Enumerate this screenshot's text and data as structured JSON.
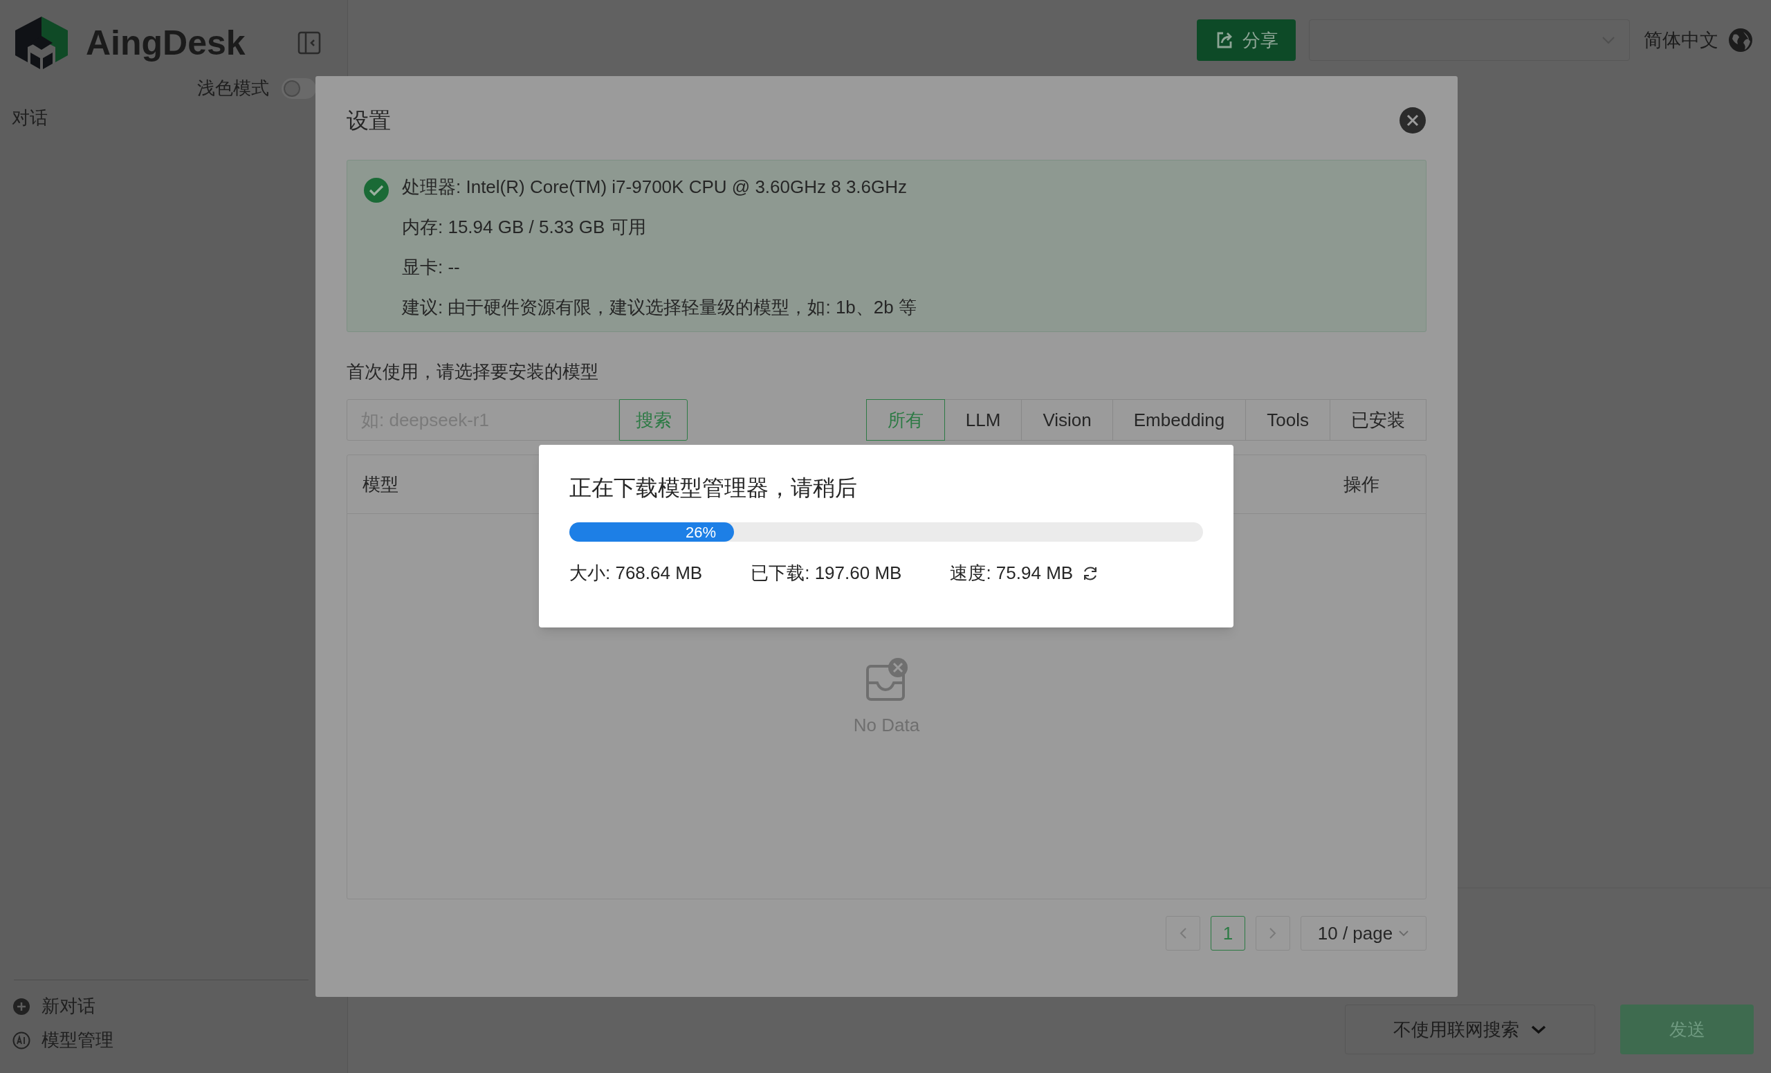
{
  "sidebar": {
    "app_name": "AingDesk",
    "theme_toggle": {
      "label": "浅色模式",
      "on": false
    },
    "section_title": "对话",
    "actions": [
      {
        "label": "新对话",
        "kind": "new"
      },
      {
        "label": "模型管理",
        "kind": "models"
      }
    ]
  },
  "header": {
    "share_button": "分享",
    "language": "简体中文"
  },
  "composer": {
    "search_mode": "不使用联网搜索",
    "send_button": "发送"
  },
  "settings_dialog": {
    "title": "设置",
    "hardware": [
      "处理器: Intel(R) Core(TM) i7-9700K CPU @ 3.60GHz 8 3.6GHz",
      "内存: 15.94 GB / 5.33 GB 可用",
      "显卡: --",
      "建议: 由于硬件资源有限，建议选择轻量级的模型，如: 1b、2b 等"
    ],
    "hint": "首次使用，请选择要安装的模型",
    "search": {
      "placeholder": "如: deepseek-r1",
      "button": "搜索"
    },
    "tabs": [
      {
        "label": "所有",
        "selected": true
      },
      {
        "label": "LLM",
        "selected": false
      },
      {
        "label": "Vision",
        "selected": false
      },
      {
        "label": "Embedding",
        "selected": false
      },
      {
        "label": "Tools",
        "selected": false
      },
      {
        "label": "已安装",
        "selected": false
      }
    ],
    "table": {
      "columns": [
        "模型",
        "操作"
      ],
      "empty_text": "No Data"
    },
    "pagination": {
      "pages": [
        {
          "label": "1",
          "selected": true
        }
      ],
      "page_size": "10 / page"
    }
  },
  "download_dialog": {
    "title": "正在下载模型管理器，请稍后",
    "level": 0.26,
    "percent": "26%",
    "stats": [
      "大小: 768.64 MB",
      "已下载: 197.60 MB",
      "速度: 75.94 MB"
    ]
  }
}
